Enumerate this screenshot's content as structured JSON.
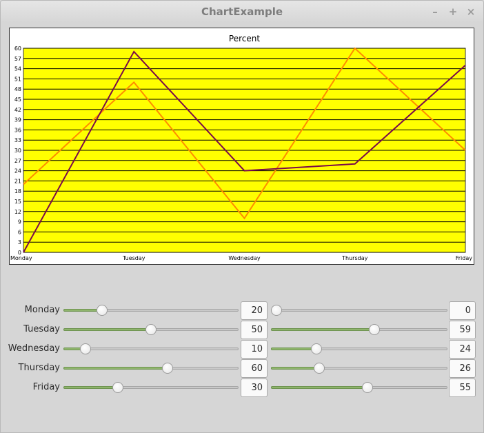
{
  "window": {
    "title": "ChartExample",
    "buttons": {
      "minimize": "–",
      "maximize": "+",
      "close": "×"
    }
  },
  "chart_data": {
    "type": "line",
    "title": "Percent",
    "categories": [
      "Monday",
      "Tuesday",
      "Wednesday",
      "Thursday",
      "Friday"
    ],
    "ylim": [
      0,
      60
    ],
    "yticks": [
      0,
      3,
      6,
      9,
      12,
      15,
      18,
      21,
      24,
      27,
      30,
      33,
      36,
      39,
      42,
      45,
      48,
      51,
      54,
      57,
      60
    ],
    "grid": true,
    "plot_background": "#ffff00",
    "series": [
      {
        "color": "#ff8c00",
        "values": [
          20,
          50,
          10,
          60,
          30
        ]
      },
      {
        "color": "#7a0a4a",
        "values": [
          0,
          59,
          24,
          26,
          55
        ]
      }
    ]
  },
  "controls": {
    "days": [
      "Monday",
      "Tuesday",
      "Wednesday",
      "Thursday",
      "Friday"
    ],
    "slider_max": 100,
    "series_a": {
      "values": [
        20,
        50,
        10,
        60,
        30
      ],
      "text": [
        "20",
        "50",
        "10",
        "60",
        "30"
      ]
    },
    "series_b": {
      "values": [
        0,
        59,
        24,
        26,
        55
      ],
      "text": [
        "0",
        "59",
        "24",
        "26",
        "55"
      ]
    }
  }
}
